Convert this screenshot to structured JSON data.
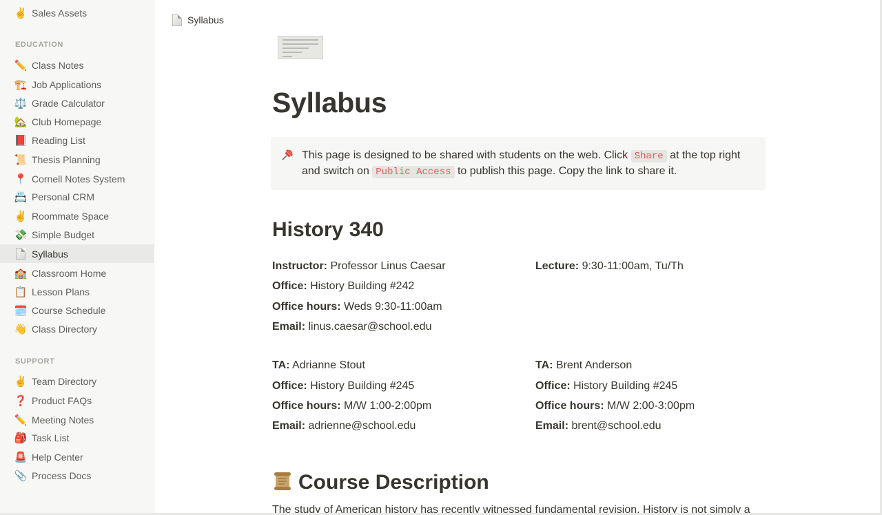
{
  "sidebar": {
    "top_item": {
      "emoji": "✌️",
      "label": "Sales Assets"
    },
    "sections": [
      {
        "heading": "EDUCATION",
        "items": [
          {
            "emoji": "✏️",
            "label": "Class Notes"
          },
          {
            "emoji": "🏗️",
            "label": "Job Applications"
          },
          {
            "emoji": "⚖️",
            "label": "Grade Calculator"
          },
          {
            "emoji": "🏡",
            "label": "Club Homepage"
          },
          {
            "emoji": "📕",
            "label": "Reading List"
          },
          {
            "emoji": "📜",
            "label": "Thesis Planning"
          },
          {
            "emoji": "📍",
            "label": "Cornell Notes System"
          },
          {
            "emoji": "📇",
            "label": "Personal CRM"
          },
          {
            "emoji": "✌️",
            "label": "Roommate Space"
          },
          {
            "emoji": "💸",
            "label": "Simple Budget"
          },
          {
            "emoji": "📄",
            "label": "Syllabus",
            "active": true
          },
          {
            "emoji": "🏫",
            "label": "Classroom Home"
          },
          {
            "emoji": "📋",
            "label": "Lesson Plans"
          },
          {
            "emoji": "🗓️",
            "label": "Course Schedule"
          },
          {
            "emoji": "👋",
            "label": "Class Directory"
          }
        ]
      },
      {
        "heading": "SUPPORT",
        "items": [
          {
            "emoji": "✌️",
            "label": "Team Directory"
          },
          {
            "emoji": "❓",
            "label": "Product FAQs"
          },
          {
            "emoji": "✏️",
            "label": "Meeting Notes"
          },
          {
            "emoji": "🎒",
            "label": "Task List"
          },
          {
            "emoji": "🚨",
            "label": "Help Center"
          },
          {
            "emoji": "📎",
            "label": "Process Docs"
          }
        ]
      }
    ]
  },
  "breadcrumb": {
    "label": "Syllabus"
  },
  "page": {
    "title": "Syllabus",
    "callout": {
      "t1": "This page is designed to be shared with students on the web. Click ",
      "code1": "Share",
      "t2": " at the top right and switch on ",
      "code2": "Public Access",
      "t3": " to publish this page. Copy the link to share it."
    },
    "course_heading": "History 340",
    "blocks": [
      {
        "label": "Instructor:",
        "value": " Professor Linus Caesar"
      },
      {
        "label": "Office:",
        "value": " History Building #242"
      },
      {
        "label": "Office hours:",
        "value": " Weds 9:30-11:00am"
      },
      {
        "label": "Email:",
        "value": " linus.caesar@school.edu"
      },
      {
        "label": "Lecture:",
        "value": " 9:30-11:00am, Tu/Th"
      },
      {
        "label": "TA:",
        "value": " Adrianne Stout"
      },
      {
        "label": "Office:",
        "value": " History Building #245"
      },
      {
        "label": "Office hours:",
        "value": " M/W 1:00-2:00pm"
      },
      {
        "label": "Email:",
        "value": " adrienne@school.edu"
      },
      {
        "label": "TA:",
        "value": " Brent Anderson"
      },
      {
        "label": "Office:",
        "value": " History Building #245"
      },
      {
        "label": "Office hours:",
        "value": " M/W 2:00-3:00pm"
      },
      {
        "label": "Email:",
        "value": " brent@school.edu"
      }
    ],
    "description_heading": "Course Description",
    "description_text": "The study of American history has recently witnessed fundamental revision. History is not simply a"
  }
}
